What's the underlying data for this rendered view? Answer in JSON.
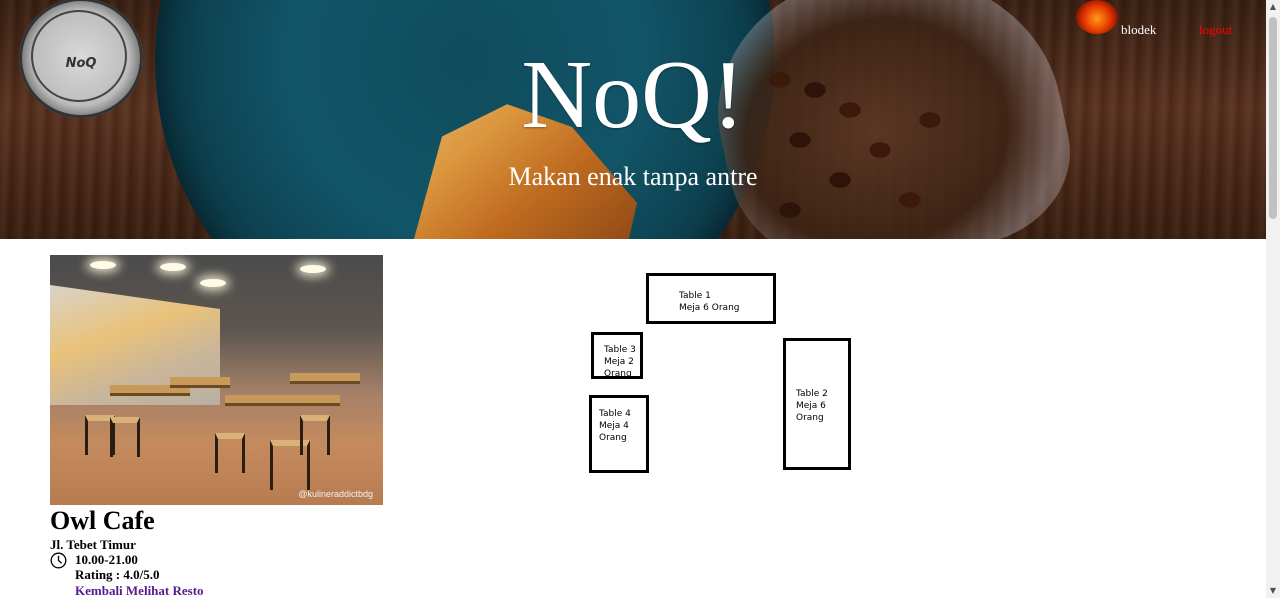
{
  "header": {
    "title": "NoQ!",
    "tagline": "Makan enak tanpa antre",
    "logo_text": "NoQ",
    "username": "blodek",
    "logout_label": "logout"
  },
  "restaurant": {
    "name": "Owl Cafe",
    "address": "Jl. Tebet Timur",
    "hours": "10.00-21.00",
    "rating": "Rating : 4.0/5.0",
    "back_link": "Kembali Melihat Resto",
    "photo_credit": "@kulineraddictbdg"
  },
  "tables": [
    {
      "name": "Table 1",
      "line1": "Meja 6 Orang",
      "line2": ""
    },
    {
      "name": "Table 2",
      "line1": "Meja 6",
      "line2": "Orang"
    },
    {
      "name": "Table 3",
      "line1": "Meja 2",
      "line2": "Orang"
    },
    {
      "name": "Table 4",
      "line1": "Meja 4",
      "line2": "Orang"
    }
  ],
  "colors": {
    "logout": "#ff0000",
    "visited_link": "#551a8b"
  },
  "icons": {
    "clock": "clock-icon",
    "scroll_up": "chevron-up-icon",
    "scroll_down": "chevron-down-icon"
  }
}
